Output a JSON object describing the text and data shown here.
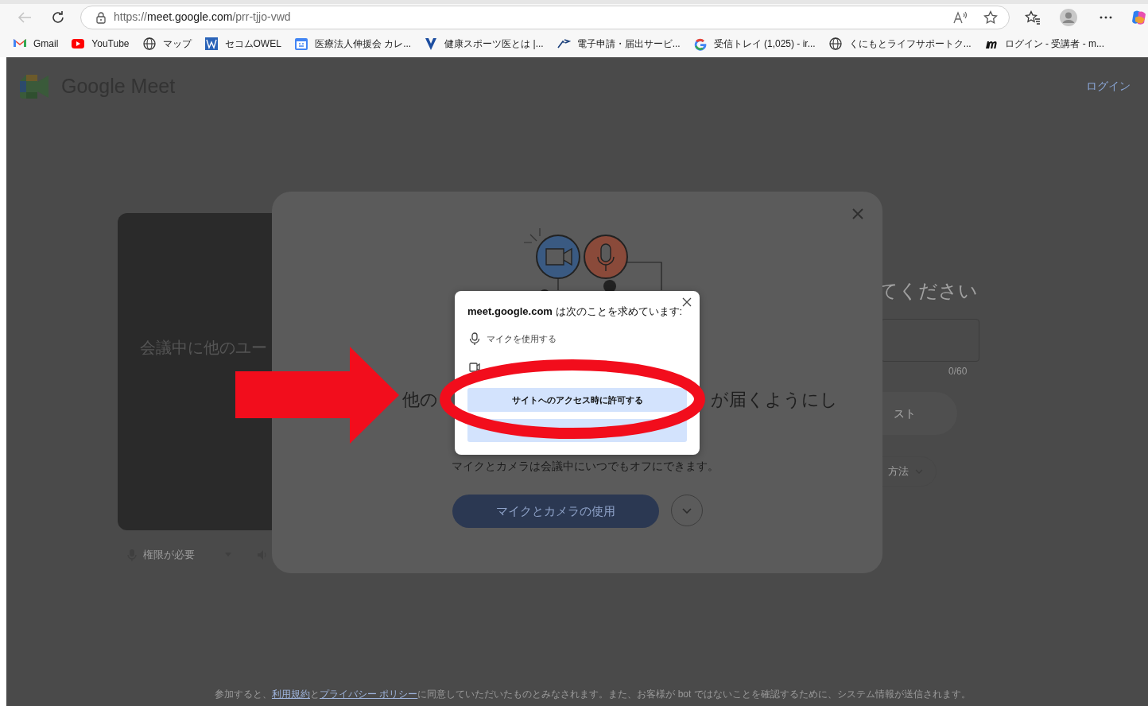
{
  "browser": {
    "address": {
      "scheme": "https://",
      "host": "meet.google.com",
      "path": "/prr-tjjo-vwd"
    },
    "bookmarks": [
      {
        "label": "Gmail",
        "kind": "gmail"
      },
      {
        "label": "YouTube",
        "kind": "youtube"
      },
      {
        "label": "マップ",
        "kind": "globe"
      },
      {
        "label": "セコムOWEL",
        "kind": "owel"
      },
      {
        "label": "医療法人伸援会 カレ...",
        "kind": "calendar"
      },
      {
        "label": "健康スポーツ医とは |...",
        "kind": "v"
      },
      {
        "label": "電子申請・届出サービ...",
        "kind": "egov"
      },
      {
        "label": "受信トレイ (1,025) - ir...",
        "kind": "google"
      },
      {
        "label": "くにもとライフサポートク...",
        "kind": "globe"
      },
      {
        "label": "ログイン - 受講者 - m...",
        "kind": "m"
      }
    ]
  },
  "page": {
    "logo": "Google Meet",
    "login": "ログイン",
    "preview_text": "会議中に他のユー",
    "mic_status": "権限が必要",
    "heading": "てください",
    "char_count": "0/60",
    "join_button": "スト",
    "other_ways": "方法",
    "footer": [
      {
        "text": "参加すると、",
        "kind": "text"
      },
      {
        "text": "利用規約",
        "kind": "link"
      },
      {
        "text": "と",
        "kind": "text"
      },
      {
        "text": "プライバシー ポリシー",
        "kind": "link"
      },
      {
        "text": "に同意していただいたものとみなされます。また、お客様が bot ではないことを確認するために、システム情報が送信されます。",
        "kind": "text"
      }
    ]
  },
  "modal": {
    "heading_left": "他の",
    "heading_right": "が届くようにし",
    "note": "マイクとカメラは会議中にいつでもオフにできます。",
    "use_button": "マイクとカメラの使用"
  },
  "permission_popup": {
    "title": "**meet.google.com** は次のことを求めています:",
    "items": [
      {
        "kind": "mic",
        "label": "マイクを使用する"
      },
      {
        "kind": "camera"
      }
    ],
    "allow_button": "サイトへのアクセス時に許可する"
  }
}
